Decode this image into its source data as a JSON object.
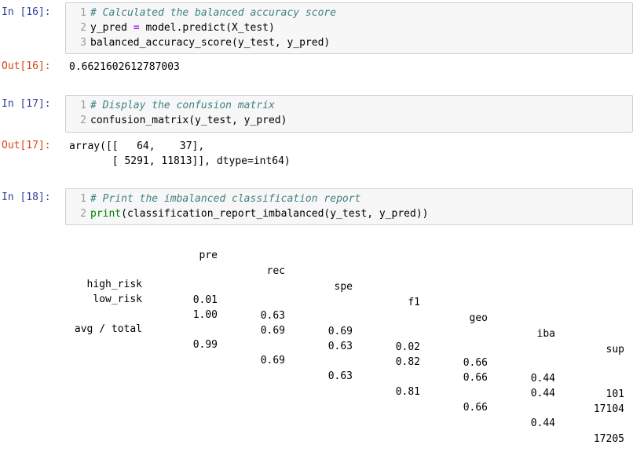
{
  "cells": {
    "c16": {
      "in_prompt": "In [16]:",
      "lines": [
        {
          "no": "1",
          "text": "# Calculated the balanced accuracy score"
        },
        {
          "no": "2",
          "a": "y_pred ",
          "op": "=",
          "b": " model.predict(X_test)"
        },
        {
          "no": "3",
          "text": "balanced_accuracy_score(y_test, y_pred)"
        }
      ],
      "out_prompt": "Out[16]:",
      "output": "0.6621602612787003"
    },
    "c17": {
      "in_prompt": "In [17]:",
      "lines": [
        {
          "no": "1",
          "text": "# Display the confusion matrix"
        },
        {
          "no": "2",
          "text": "confusion_matrix(y_test, y_pred)"
        }
      ],
      "out_prompt": "Out[17]:",
      "output_lines": [
        "array([[   64,    37],",
        "       [ 5291, 11813]], dtype=int64)"
      ]
    },
    "c18": {
      "in_prompt": "In [18]:",
      "lines": [
        {
          "no": "1",
          "text": "# Print the imbalanced classification report"
        },
        {
          "no": "2",
          "fn": "print",
          "rest": "(classification_report_imbalanced(y_test, y_pred))"
        }
      ]
    }
  },
  "report": {
    "headers": [
      "pre",
      "rec",
      "spe",
      "f1",
      "geo",
      "iba",
      "sup"
    ],
    "rows": [
      {
        "label": "high_risk",
        "values": [
          "0.01",
          "0.63",
          "0.69",
          "0.02",
          "0.66",
          "0.44",
          "101"
        ]
      },
      {
        "label": "low_risk",
        "values": [
          "1.00",
          "0.69",
          "0.63",
          "0.82",
          "0.66",
          "0.44",
          "17104"
        ]
      },
      {
        "label": "avg / total",
        "values": [
          "0.99",
          "0.69",
          "0.63",
          "0.81",
          "0.66",
          "0.44",
          "17205"
        ]
      }
    ]
  },
  "colors": {
    "in_prompt": "#303f9f",
    "out_prompt": "#d84315",
    "comment": "#408080",
    "builtin": "#008000",
    "operator": "#aa22ff",
    "editor_bg": "#f7f7f7"
  }
}
